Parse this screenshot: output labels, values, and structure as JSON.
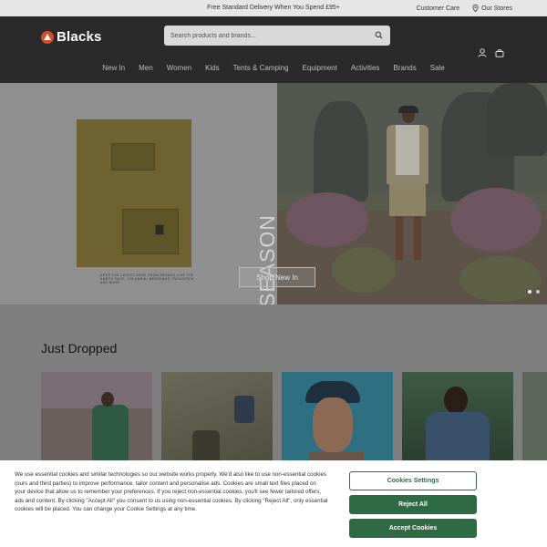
{
  "topbar": {
    "promo": "Free Standard Delivery When You Spend £95+",
    "customer_care": "Customer Care",
    "our_stores": "Our Stores"
  },
  "header": {
    "logo_text": "Blacks",
    "search_placeholder": "Search products and brands...",
    "icons": [
      "search-icon",
      "account-icon",
      "basket-icon"
    ]
  },
  "nav": [
    "New In",
    "Men",
    "Women",
    "Kids",
    "Tents & Camping",
    "Equipment",
    "Activities",
    "Brands",
    "Sale"
  ],
  "hero": {
    "vertical_text": "NEW SEASON",
    "button_label": "Shop New In",
    "small_print": "SHOP THE LATEST DROP FROM BRANDS LIKE THE NORTH FACE, COLUMBIA, BERGHAUS, PATAGONIA AND MORE"
  },
  "just_dropped": {
    "title": "Just Dropped"
  },
  "cookie": {
    "text": "We use essential cookies and similar technologies so our website works properly. We'd also like to use non-essential cookies (ours and third parties) to improve performance, tailor content and personalise ads. Cookies are small text files placed on your device that allow us to remember your preferences. If you reject non-essential cookies, you'll see fewer tailored offers, ads and content. By clicking \"Accept All\" you consent to us using non-essential cookies. By clicking \"Reject All\", only essential cookies will be placed. You can change your Cookie Settings at any time.",
    "settings_label": "Cookies Settings",
    "reject_label": "Reject All",
    "accept_label": "Accept Cookies"
  },
  "colors": {
    "header_bg": "#2a2a2a",
    "logo_red": "#d9492a",
    "cookie_green": "#2e6b45"
  }
}
